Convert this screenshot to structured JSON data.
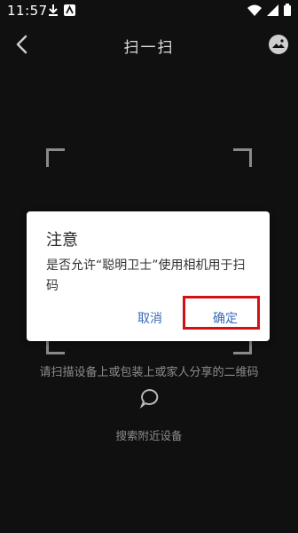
{
  "status_bar": {
    "time": "11:57",
    "left_icons": [
      "download-icon",
      "app-notification-icon"
    ],
    "right_icons": [
      "wifi-icon",
      "cellular-icon",
      "battery-icon"
    ]
  },
  "header": {
    "title": "扫一扫",
    "left_icon": "back-icon",
    "right_icon": "gallery-icon"
  },
  "scanner": {
    "hint": "请扫描设备上或包装上或家人分享的二维码",
    "nearby_label": "搜索附近设备",
    "nearby_icon": "chat-bubble-icon"
  },
  "dialog": {
    "title": "注意",
    "message": "是否允许“聪明卫士”使用相机用于扫码",
    "cancel_label": "取消",
    "confirm_label": "确定",
    "highlight_color": "#d01212"
  },
  "colors": {
    "background": "#101010",
    "dialog_button": "#3a6ab5"
  }
}
